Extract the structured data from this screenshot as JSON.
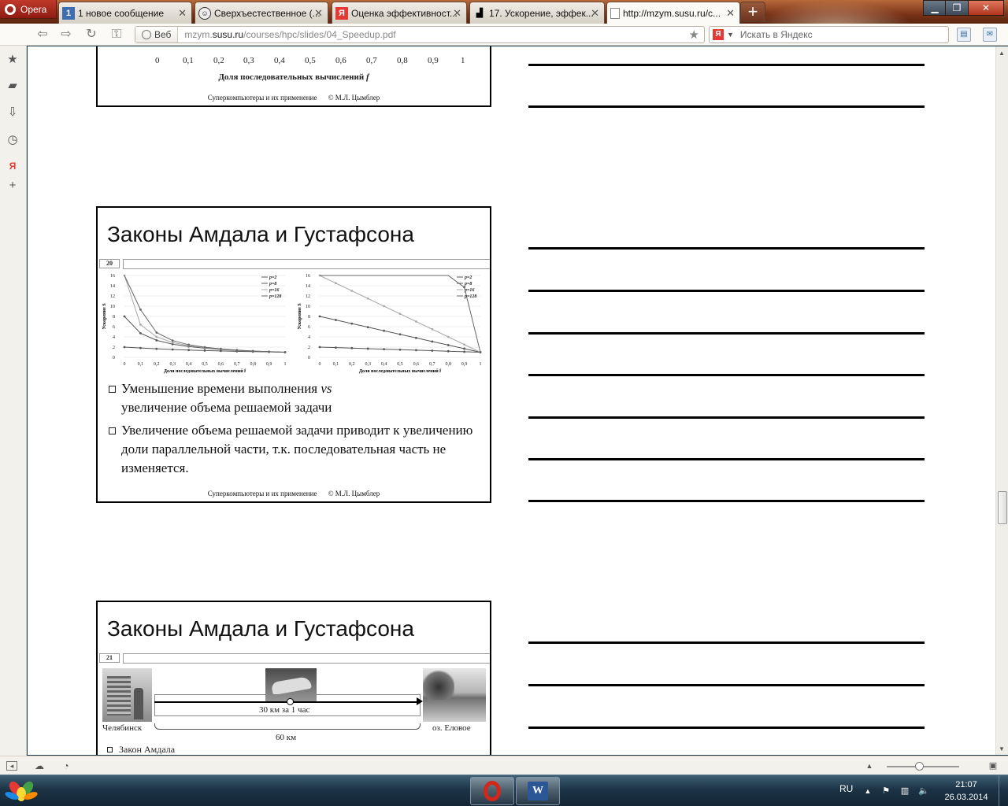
{
  "browser": {
    "app_menu_label": "Opera",
    "tabs": [
      {
        "title": "1 новое сообщение",
        "favicon": "1"
      },
      {
        "title": "Сверхъестественное (...",
        "favicon": "face"
      },
      {
        "title": "Оценка эффективност...",
        "favicon": "Я"
      },
      {
        "title": "17. Ускорение, эффек...",
        "favicon": "page"
      },
      {
        "title": "http://mzym.susu.ru/c...",
        "favicon": "doc"
      }
    ],
    "new_tab_label": "+",
    "address_badge": "Веб",
    "url_prefix": "mzym.",
    "url_domain": "susu.ru",
    "url_path": "/courses/hpc/slides/04_Speedup.pdf",
    "search_placeholder": "Искать в Яндекс",
    "search_engine_badge": "Я"
  },
  "slides": [
    {
      "id": "slide-19-bottom",
      "x_ticks": [
        "0",
        "0,1",
        "0,2",
        "0,3",
        "0,4",
        "0,5",
        "0,6",
        "0,7",
        "0,8",
        "0,9",
        "1"
      ],
      "x_label": "Доля последовательных вычислений",
      "x_label_var": "f",
      "footer_left": "Суперкомпьютеры и их применение",
      "footer_right": "© М.Л. Цымблер"
    },
    {
      "id": "slide-20",
      "title": "Законы Амдала и Густафсона",
      "number": "20",
      "charts": {
        "y_ticks": [
          "16",
          "14",
          "12",
          "10",
          "8",
          "6",
          "4",
          "2",
          "0"
        ],
        "x_ticks": [
          "0",
          "0,1",
          "0,2",
          "0,3",
          "0,4",
          "0,5",
          "0,6",
          "0,7",
          "0,8",
          "0,9",
          "1"
        ],
        "y_label": "Ускорение S",
        "x_label": "Доля последовательных вычислений f",
        "legend": [
          "p=2",
          "p=8",
          "p=16",
          "p=128"
        ]
      },
      "bullets": [
        {
          "text": "Уменьшение времени выполнения",
          "italic": "vs",
          "rest": "увеличение объема решаемой задачи"
        },
        {
          "text": "Увеличение объема решаемой задачи приводит к увеличению доли параллельной части, т.к. последовательная часть не изменяется."
        }
      ],
      "footer_left": "Суперкомпьютеры и их применение",
      "footer_right": "© М.Л. Цымблер"
    },
    {
      "id": "slide-21",
      "title": "Законы Амдала и Густафсона",
      "number": "21",
      "left_place": "Челябинск",
      "right_place": "оз. Еловое",
      "speed_label": "30 км за 1 час",
      "distance_label": "60 км",
      "bullet": "Закон Амдала"
    }
  ],
  "chart_data": [
    {
      "type": "line",
      "title": "",
      "xlabel": "Доля последовательных вычислений f",
      "ylabel": "Ускорение S",
      "x": [
        0,
        0.1,
        0.2,
        0.3,
        0.4,
        0.5,
        0.6,
        0.7,
        0.8,
        0.9,
        1
      ],
      "ylim": [
        0,
        16
      ],
      "series": [
        {
          "name": "p=2",
          "values": [
            2,
            1.82,
            1.67,
            1.54,
            1.43,
            1.33,
            1.25,
            1.18,
            1.11,
            1.05,
            1
          ]
        },
        {
          "name": "p=8",
          "values": [
            8,
            4.71,
            3.33,
            2.58,
            2.11,
            1.78,
            1.54,
            1.36,
            1.21,
            1.1,
            1
          ]
        },
        {
          "name": "p=16",
          "values": [
            16,
            6.4,
            4,
            2.91,
            2.29,
            1.88,
            1.6,
            1.39,
            1.23,
            1.1,
            1
          ]
        },
        {
          "name": "p=128",
          "values": [
            128,
            9.34,
            4.85,
            3.28,
            2.47,
            1.98,
            1.66,
            1.42,
            1.24,
            1.11,
            1
          ]
        }
      ]
    },
    {
      "type": "line",
      "title": "",
      "xlabel": "Доля последовательных вычислений f",
      "ylabel": "Ускорение S",
      "x": [
        0,
        0.1,
        0.2,
        0.3,
        0.4,
        0.5,
        0.6,
        0.7,
        0.8,
        0.9,
        1
      ],
      "ylim": [
        0,
        16
      ],
      "series": [
        {
          "name": "p=2",
          "values": [
            2,
            1.9,
            1.8,
            1.7,
            1.6,
            1.5,
            1.4,
            1.3,
            1.2,
            1.1,
            1
          ]
        },
        {
          "name": "p=8",
          "values": [
            8,
            7.3,
            6.6,
            5.9,
            5.2,
            4.5,
            3.8,
            3.1,
            2.4,
            1.7,
            1
          ]
        },
        {
          "name": "p=16",
          "values": [
            16,
            14.5,
            13,
            11.5,
            10,
            8.5,
            7,
            5.5,
            4,
            2.5,
            1
          ]
        },
        {
          "name": "p=128",
          "values": [
            128,
            115.3,
            102.6,
            89.9,
            77.2,
            64.5,
            51.8,
            39.1,
            26.4,
            13.7,
            1
          ]
        }
      ]
    }
  ],
  "statusbar": {},
  "taskbar": {
    "language": "RU",
    "time": "21:07",
    "date": "26.03.2014"
  }
}
